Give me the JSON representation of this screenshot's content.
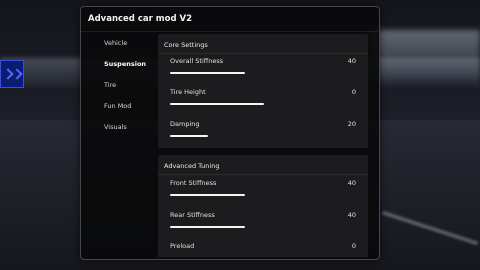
{
  "window": {
    "title": "Advanced car mod V2"
  },
  "tabs": [
    {
      "label": "Vehicle",
      "active": false
    },
    {
      "label": "Suspension",
      "active": true
    },
    {
      "label": "Tire",
      "active": false
    },
    {
      "label": "Fun Mod",
      "active": false
    },
    {
      "label": "Visuals",
      "active": false
    }
  ],
  "sections": [
    {
      "title": "Core Settings",
      "rows": [
        {
          "label": "Overall Stiffness",
          "value": "40",
          "level": 0.4
        },
        {
          "label": "Tire Height",
          "value": "0",
          "level": 0.5
        },
        {
          "label": "Damping",
          "value": "20",
          "level": 0.2
        }
      ]
    },
    {
      "title": "Advanced Tuning",
      "rows": [
        {
          "label": "Front Stiffness",
          "value": "40",
          "level": 0.4
        },
        {
          "label": "Rear Stiffness",
          "value": "40",
          "level": 0.4
        },
        {
          "label": "Preload",
          "value": "0",
          "level": 0
        }
      ]
    }
  ],
  "colors": {
    "accent": "#f4f4f4",
    "panel": "#0a0a0b",
    "section": "#1c1c1e",
    "sign": "#2f4cff"
  }
}
